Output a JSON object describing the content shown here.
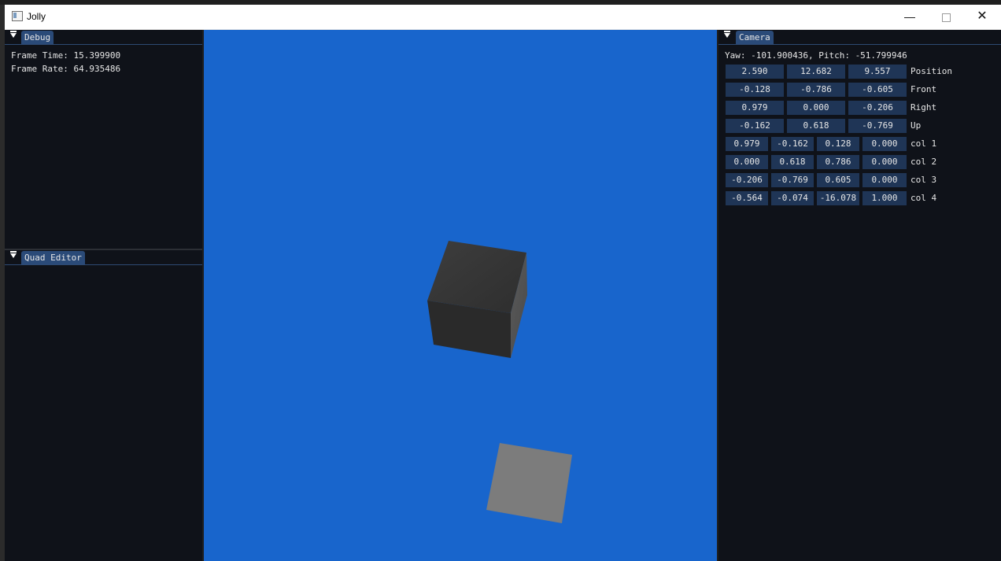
{
  "window": {
    "title": "Jolly"
  },
  "debug": {
    "tab": "Debug",
    "frame_time": "Frame Time: 15.399900",
    "frame_rate": "Frame Rate: 64.935486"
  },
  "quad_editor": {
    "tab": "Quad Editor"
  },
  "camera": {
    "tab": "Camera",
    "yaw_pitch": "Yaw: -101.900436, Pitch: -51.799946",
    "vectors": [
      {
        "label": "Position",
        "values": [
          "2.590",
          "12.682",
          "9.557"
        ]
      },
      {
        "label": "Front",
        "values": [
          "-0.128",
          "-0.786",
          "-0.605"
        ]
      },
      {
        "label": "Right",
        "values": [
          "0.979",
          "0.000",
          "-0.206"
        ]
      },
      {
        "label": "Up",
        "values": [
          "-0.162",
          "0.618",
          "-0.769"
        ]
      }
    ],
    "matrix": [
      {
        "label": "col 1",
        "values": [
          "0.979",
          "-0.162",
          "0.128",
          "0.000"
        ]
      },
      {
        "label": "col 2",
        "values": [
          "0.000",
          "0.618",
          "0.786",
          "0.000"
        ]
      },
      {
        "label": "col 3",
        "values": [
          "-0.206",
          "-0.769",
          "0.605",
          "0.000"
        ]
      },
      {
        "label": "col 4",
        "values": [
          "-0.564",
          "-0.074",
          "-16.078",
          "1.000"
        ]
      }
    ]
  },
  "colors": {
    "viewport_bg": "#1865cc",
    "panel_bg": "#0f1219",
    "tab_active": "#2a4a78",
    "field_bg": "#1f3556"
  }
}
